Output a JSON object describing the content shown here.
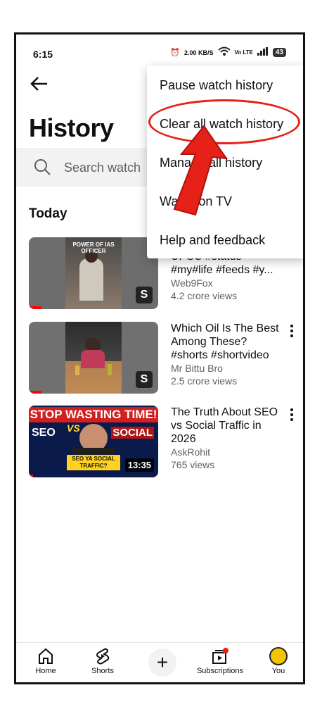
{
  "status_bar": {
    "time": "6:15",
    "speed": "2.00 KB/S",
    "network": "Vo LTE",
    "battery": "43"
  },
  "header": {
    "title": "History"
  },
  "search": {
    "placeholder": "Search watch"
  },
  "section": {
    "today": "Today"
  },
  "videos": [
    {
      "title_partial": "UPSC #status #my#life #feeds #y...",
      "channel": "Web9Fox",
      "views": "4.2 crore views",
      "thumb_text": "POWER OF IAS OFFICER"
    },
    {
      "title": "Which Oil Is The Best Among These? #shorts #shortvideo",
      "channel": "Mr Bittu Bro",
      "views": "2.5 crore views"
    },
    {
      "title": "The Truth About SEO vs Social Traffic in 2026",
      "channel": "AskRohit",
      "views": "765 views",
      "duration": "13:35",
      "thumb_text": {
        "top": "STOP WASTING TIME!",
        "left": "SEO",
        "vs": "VS",
        "right": "SOCIAL",
        "bottom": "SEO YA SOCIAL TRAFFIC?"
      }
    }
  ],
  "menu": {
    "items": [
      "Pause watch history",
      "Clear all watch history",
      "Manage all history",
      "Watch on TV",
      "Help and feedback"
    ]
  },
  "bottom_nav": {
    "home": "Home",
    "shorts": "Shorts",
    "subscriptions": "Subscriptions",
    "you": "You"
  },
  "colors": {
    "accent_red": "#e62117",
    "progress_red": "#ff0000"
  }
}
